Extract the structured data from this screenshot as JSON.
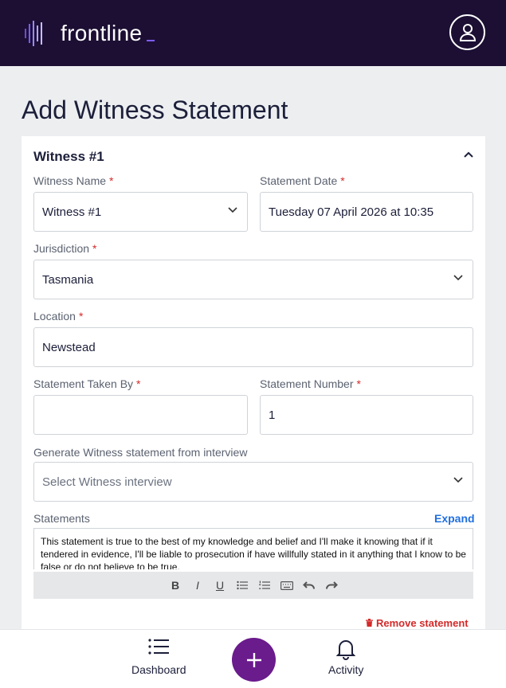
{
  "app": {
    "brand": "frontline",
    "colors": {
      "header_bg": "#1c0f33",
      "accent": "#6a1b8c",
      "required": "#d42a2a",
      "link": "#1f6fe0"
    }
  },
  "header": {
    "profile_icon": "user-icon"
  },
  "page": {
    "title": "Add Witness Statement"
  },
  "witness": {
    "heading": "Witness #1",
    "fields": {
      "witness_name": {
        "label": "Witness Name",
        "required": "*",
        "value": "Witness #1"
      },
      "statement_date": {
        "label": "Statement Date",
        "required": "*",
        "value": "Tuesday 07 April 2026 at 10:35"
      },
      "jurisdiction": {
        "label": "Jurisdiction",
        "required": "*",
        "value": "Tasmania"
      },
      "location": {
        "label": "Location",
        "required": "*",
        "value": "Newstead"
      },
      "taken_by": {
        "label": "Statement Taken By",
        "required": "*",
        "value": ""
      },
      "statement_number": {
        "label": "Statement Number",
        "required": "*",
        "value": "1"
      },
      "interview": {
        "label": "Generate Witness statement from interview",
        "placeholder": "Select Witness interview"
      }
    },
    "statements": {
      "label": "Statements",
      "expand": "Expand",
      "text": "This statement is true to the best of my knowledge and belief and I'll make it knowing that if it tendered in evidence, I'll be liable to prosecution if have willfully stated in it anything that I know to be false or do not believe to be true."
    },
    "toolbar": {
      "bold": "B",
      "italic": "I",
      "underline": "U"
    },
    "remove_label": "Remove statement"
  },
  "bottom_nav": {
    "dashboard": "Dashboard",
    "activity": "Activity"
  }
}
